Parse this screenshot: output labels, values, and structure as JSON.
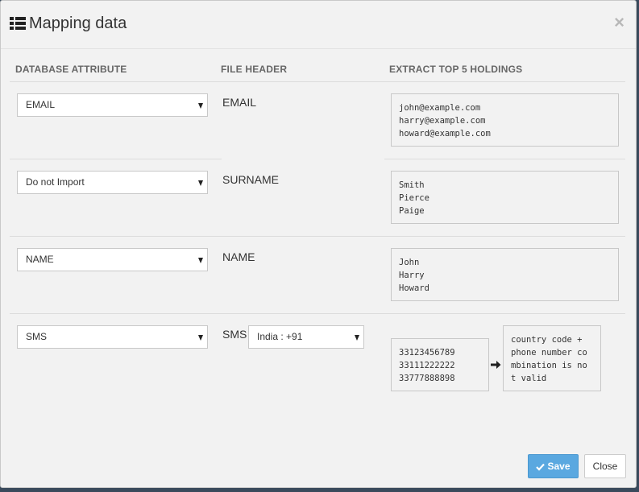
{
  "dialog": {
    "title": "Mapping data",
    "close_symbol": "×",
    "icon": "list-icon"
  },
  "columns": {
    "database_attribute": "DATABASE ATTRIBUTE",
    "file_header": "FILE HEADER",
    "extract": "EXTRACT TOP 5 HOLDINGS"
  },
  "rows": [
    {
      "attribute": "EMAIL",
      "header": "EMAIL",
      "values": "john@example.com\nharry@example.com\nhoward@example.com"
    },
    {
      "attribute": "Do not Import",
      "header": "SURNAME",
      "values": "Smith\nPierce\nPaige"
    },
    {
      "attribute": "NAME",
      "header": "NAME",
      "values": "John\nHarry\nHoward"
    },
    {
      "attribute": "SMS",
      "header": "SMS",
      "country_code": "India : +91",
      "values": "33123456789\n33111222222\n33777888898",
      "validation_message": "country code +\nphone number co\nmbination is no\nt valid"
    }
  ],
  "footer": {
    "save_label": "Save",
    "close_label": "Close"
  },
  "colors": {
    "save_button": "#5aa8e0",
    "background": "#f2f2f2"
  }
}
